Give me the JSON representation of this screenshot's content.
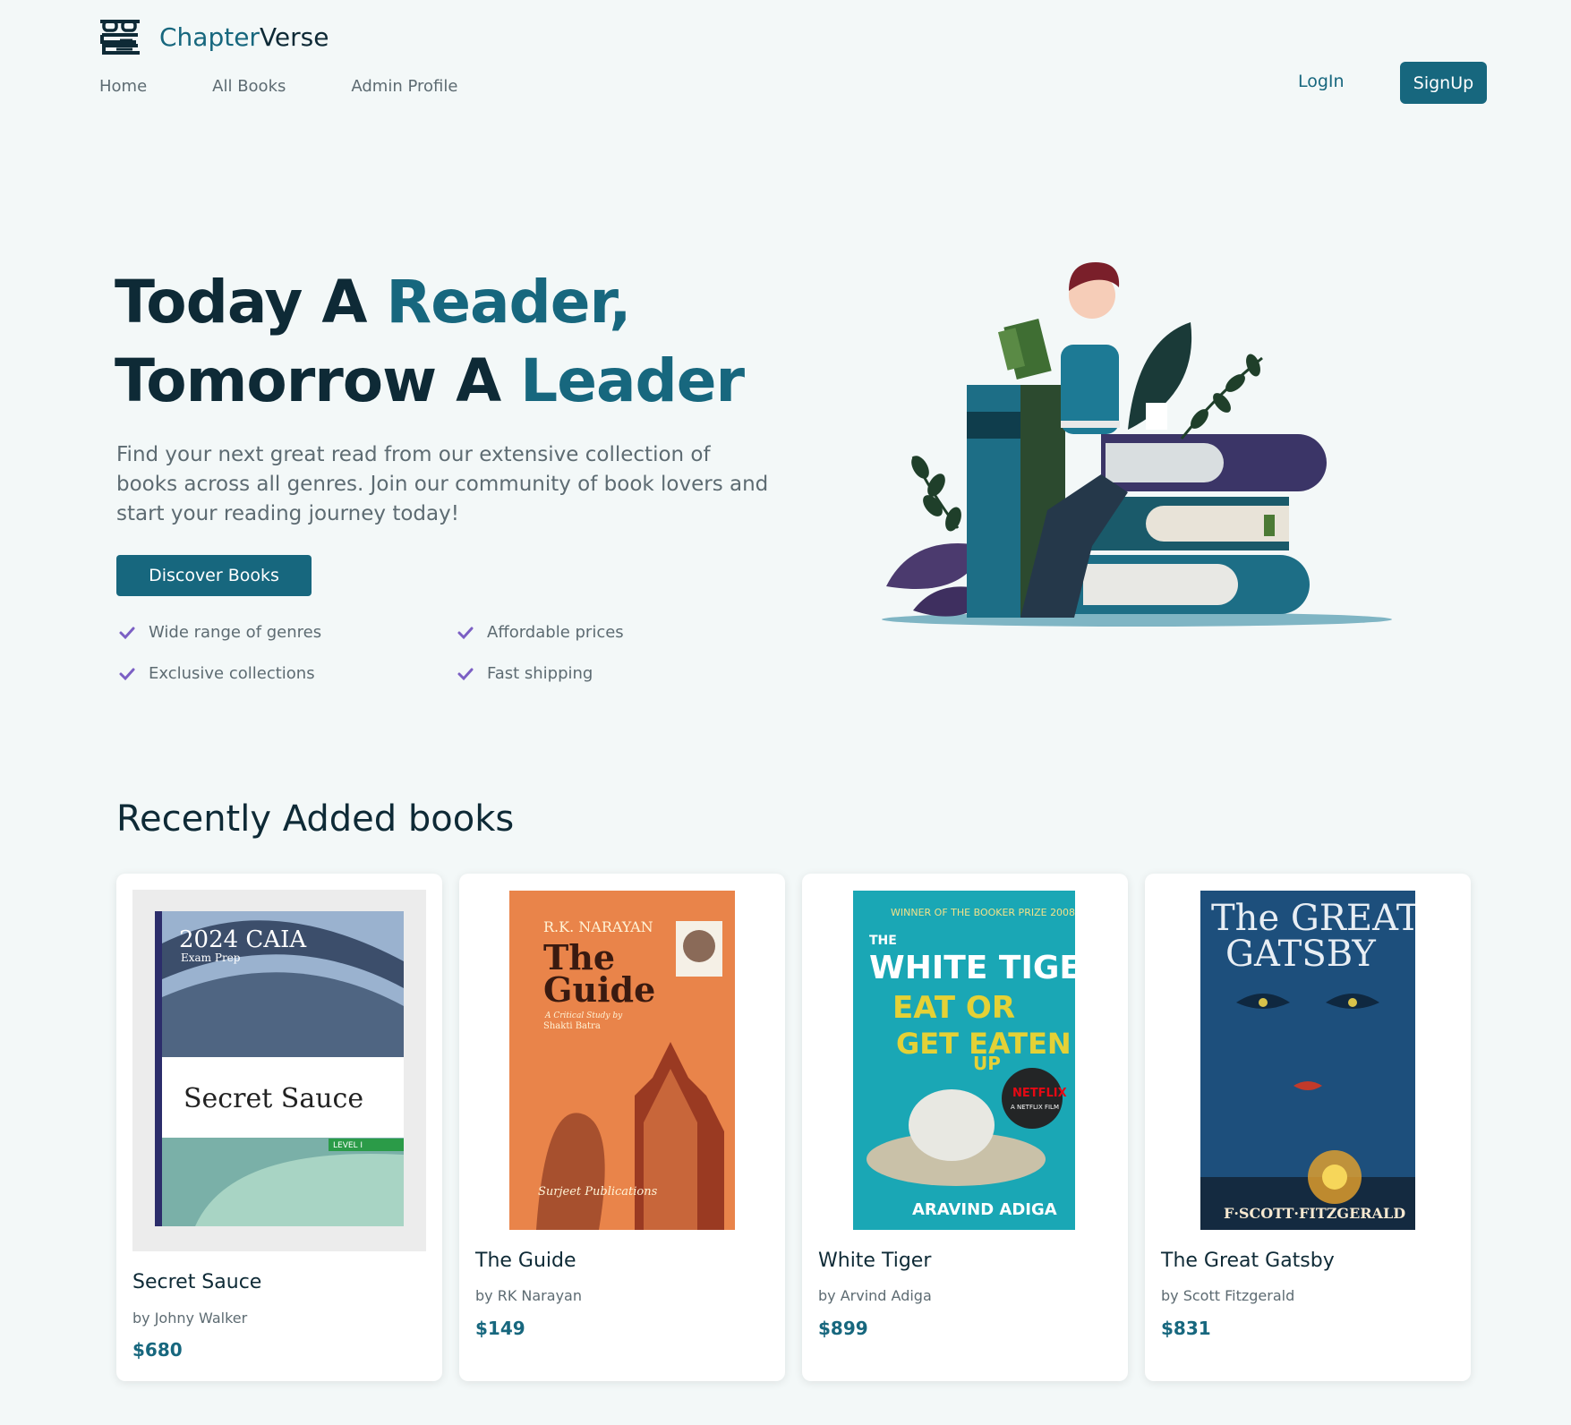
{
  "brand": {
    "name_part1": "Chapter",
    "name_part2": "Verse",
    "logo_icon": "reading-glasses-books-icon"
  },
  "nav": {
    "links": [
      "Home",
      "All Books",
      "Admin Profile"
    ],
    "login": "LogIn",
    "signup": "SignUp"
  },
  "hero": {
    "title_line1_a": "Today A ",
    "title_line1_b": "Reader,",
    "title_line2_a": "Tomorrow A ",
    "title_line2_b": "Leader",
    "description": "Find your next great read from our extensive collection of books across all genres. Join our community of book lovers and start your reading journey today!",
    "cta": "Discover Books",
    "features": [
      "Wide range of genres",
      "Affordable prices",
      "Exclusive collections",
      "Fast shipping"
    ],
    "feature_icon": "check-icon",
    "accent_color": "#17677e",
    "check_color": "#7b5fc4"
  },
  "recent": {
    "title": "Recently Added books",
    "books": [
      {
        "title": "Secret Sauce",
        "author": "by Johny Walker",
        "price": "$680",
        "cover_text": [
          "2024 CAIA",
          "Exam Prep",
          "Secret Sauce",
          "LEVEL I"
        ]
      },
      {
        "title": "The Guide",
        "author": "by RK Narayan",
        "price": "$149",
        "cover_text": [
          "R.K. NARAYAN",
          "The",
          "Guide",
          "A Critical Study by",
          "Shakti Batra",
          "Surjeet Publications"
        ]
      },
      {
        "title": "White Tiger",
        "author": "by Arvind Adiga",
        "price": "$899",
        "cover_text": [
          "WINNER OF THE BOOKER PRIZE 2008",
          "THE",
          "WHITE TIGER",
          "EAT OR",
          "GET EATEN",
          "UP",
          "NETFLIX",
          "A NETFLIX FILM",
          "ARAVIND ADIGA"
        ]
      },
      {
        "title": "The Great Gatsby",
        "author": "by Scott Fitzgerald",
        "price": "$831",
        "cover_text": [
          "The GREAT",
          "GATSBY",
          "F·SCOTT·FITZGERALD"
        ]
      }
    ]
  }
}
